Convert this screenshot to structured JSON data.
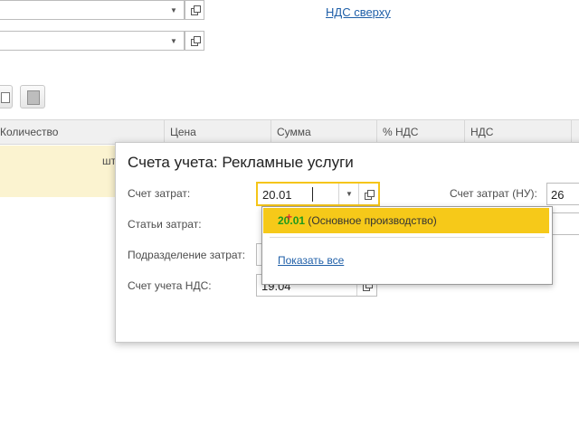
{
  "form": {
    "vat_on_top_link": "НДС сверху"
  },
  "table": {
    "headers": [
      "Количество",
      "Цена",
      "Сумма",
      "% НДС",
      "НДС"
    ],
    "row_unit": "шт"
  },
  "popup": {
    "title": "Счета учета: Рекламные услуги",
    "cost_account_label": "Счет затрат:",
    "cost_account_value": "20.01",
    "tax_account_label": "Счет затрат (НУ):",
    "tax_account_value": "26",
    "cost_items_label": "Статьи затрат:",
    "department_label": "Подразделение затрат:",
    "vat_account_label": "Счет учета НДС:",
    "vat_account_value": "19.04"
  },
  "dropdown": {
    "item_code_match": "20",
    "item_code_rest": ".01",
    "item_desc": " (Основное производство)",
    "show_all_label": "Показать все"
  },
  "icons": {
    "dropdown": "chevron-down-icon",
    "open": "open-form-icon",
    "copy": "copy-icon",
    "paste": "paste-icon"
  },
  "colors": {
    "highlight": "#f6c919",
    "focus_border": "#f5c518",
    "selected_row": "#fbf3d0",
    "match_text": "#1d9a1d",
    "link": "#1f5fa8"
  }
}
